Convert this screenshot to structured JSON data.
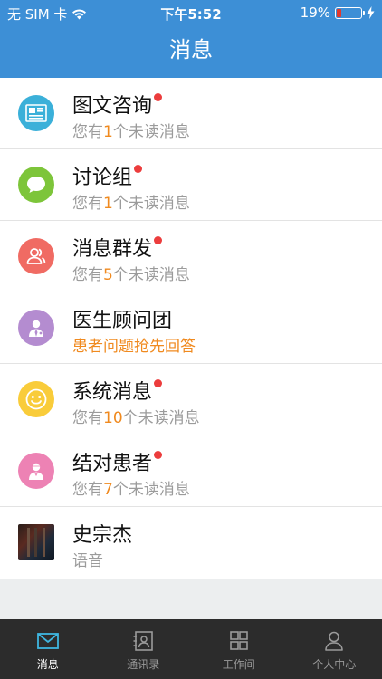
{
  "status_bar": {
    "carrier": "无 SIM 卡",
    "time": "下午5:52",
    "battery_percent": "19%",
    "battery_level": 0.19
  },
  "header": {
    "title": "消息"
  },
  "messages": [
    {
      "title": "图文咨询",
      "pre": "您有",
      "count": "1",
      "post": "个未读消息",
      "unread_dot": true,
      "icon": "newspaper-icon",
      "color": "#3bb0d9"
    },
    {
      "title": "讨论组",
      "pre": "您有",
      "count": "1",
      "post": "个未读消息",
      "unread_dot": true,
      "icon": "chat-bubble-icon",
      "color": "#7dc53a"
    },
    {
      "title": "消息群发",
      "pre": "您有",
      "count": "5",
      "post": "个未读消息",
      "unread_dot": true,
      "icon": "group-users-icon",
      "color": "#f06b63"
    },
    {
      "title": "医生顾问团",
      "subtitle": "患者问题抢先回答",
      "unread_dot": false,
      "icon": "doctor-icon",
      "color": "#b48cd0"
    },
    {
      "title": "系统消息",
      "pre": "您有",
      "count": "10",
      "post": "个未读消息",
      "unread_dot": true,
      "icon": "smiley-icon",
      "color": "#f9cc3a"
    },
    {
      "title": "结对患者",
      "pre": "您有",
      "count": "7",
      "post": "个未读消息",
      "unread_dot": true,
      "icon": "patient-icon",
      "color": "#ed82b4"
    },
    {
      "title": "史宗杰",
      "subtitle_gray": "语音",
      "unread_dot": false,
      "icon": "user-photo"
    }
  ],
  "tabs": [
    {
      "label": "消息",
      "icon": "mail-icon",
      "active": true
    },
    {
      "label": "通讯录",
      "icon": "contacts-icon",
      "active": false
    },
    {
      "label": "工作间",
      "icon": "grid-icon",
      "active": false
    },
    {
      "label": "个人中心",
      "icon": "person-icon",
      "active": false
    }
  ]
}
